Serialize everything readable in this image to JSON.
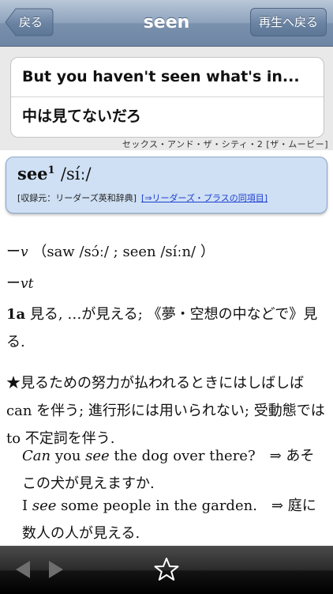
{
  "navbar": {
    "title": "seen",
    "back_label": "戻る",
    "return_label": "再生へ戻る"
  },
  "phrase": {
    "english": "But you haven't seen what's in...",
    "japanese": "中は見てないだろ",
    "source": "セックス・アンド・ザ・シティ・2 [ザ・ムービー]"
  },
  "entry": {
    "headword": "see",
    "homograph": "1",
    "pronunciation": "/síː/",
    "source_label": "[収録元：リーダーズ英和辞典]",
    "link_label": "[⇒リーダーズ・プラスの同項目]"
  },
  "definition": {
    "dash": "ー",
    "pos1": "v",
    "forms": "（saw /sɔ́ː/ ; seen /síːn/ ）",
    "pos2": "vt",
    "sense_1a_num": "1a",
    "sense_1a_text": " 見る, …が見える; 《夢・空想の中などで》見る.",
    "note": "★見るための努力が払われるときにはしばしば can を伴う; 進行形には用いられない; 受動態では to 不定詞を伴う.",
    "ex1_w1": "Can",
    "ex1_mid": " you ",
    "ex1_w2": "see",
    "ex1_rest": " the dog over there?　⇒ あそこの犬が見えますか.",
    "ex2_pre": "I ",
    "ex2_w": "see",
    "ex2_rest": " some people in the garden.　⇒ 庭に数人の人が見える."
  },
  "toolbar": {
    "prev_icon": "left-arrow-icon",
    "next_icon": "right-arrow-icon",
    "star_icon": "star-icon"
  }
}
